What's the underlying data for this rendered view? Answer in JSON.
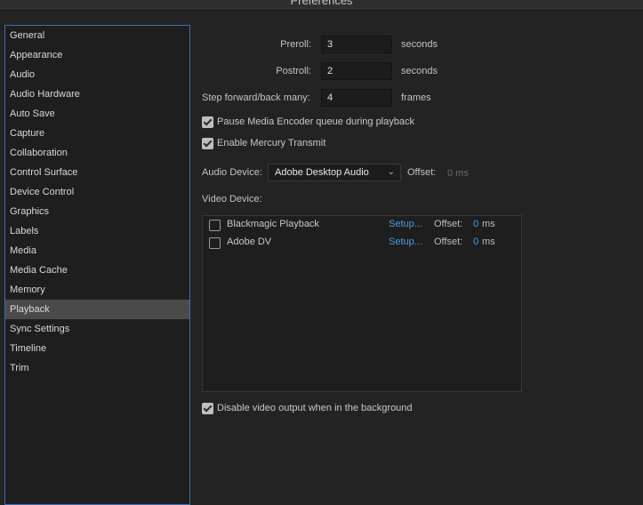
{
  "window": {
    "title": "Preferences"
  },
  "sidebar": {
    "items": [
      {
        "label": "General"
      },
      {
        "label": "Appearance"
      },
      {
        "label": "Audio"
      },
      {
        "label": "Audio Hardware"
      },
      {
        "label": "Auto Save"
      },
      {
        "label": "Capture"
      },
      {
        "label": "Collaboration"
      },
      {
        "label": "Control Surface"
      },
      {
        "label": "Device Control"
      },
      {
        "label": "Graphics"
      },
      {
        "label": "Labels"
      },
      {
        "label": "Media"
      },
      {
        "label": "Media Cache"
      },
      {
        "label": "Memory"
      },
      {
        "label": "Playback"
      },
      {
        "label": "Sync Settings"
      },
      {
        "label": "Timeline"
      },
      {
        "label": "Trim"
      }
    ],
    "selected": "Playback"
  },
  "playback": {
    "preroll": {
      "label": "Preroll:",
      "value": "3",
      "unit": "seconds"
    },
    "postroll": {
      "label": "Postroll:",
      "value": "2",
      "unit": "seconds"
    },
    "step": {
      "label": "Step forward/back many:",
      "value": "4",
      "unit": "frames"
    },
    "pause_encoder": {
      "label": "Pause Media Encoder queue during playback",
      "checked": true
    },
    "mercury": {
      "label": "Enable Mercury Transmit",
      "checked": true
    },
    "audio_device": {
      "label": "Audio Device:",
      "value": "Adobe Desktop Audio",
      "offset_label": "Offset:",
      "offset_value": "0 ms"
    },
    "video_device": {
      "label": "Video Device:",
      "devices": [
        {
          "name": "Blackmagic Playback",
          "setup": "Setup...",
          "offset_label": "Offset:",
          "offset_value": "0",
          "unit": "ms",
          "checked": false
        },
        {
          "name": "Adobe DV",
          "setup": "Setup...",
          "offset_label": "Offset:",
          "offset_value": "0",
          "unit": "ms",
          "checked": false
        }
      ]
    },
    "disable_bg": {
      "label": "Disable video output when in the background",
      "checked": true
    }
  },
  "colors": {
    "accent": "#4d9be3",
    "selection": "#4a4a4a",
    "sidebar_border": "#3d6fb7"
  },
  "icons": {
    "dropdown": "chevron-down-icon",
    "checkbox": "checkmark-icon"
  }
}
